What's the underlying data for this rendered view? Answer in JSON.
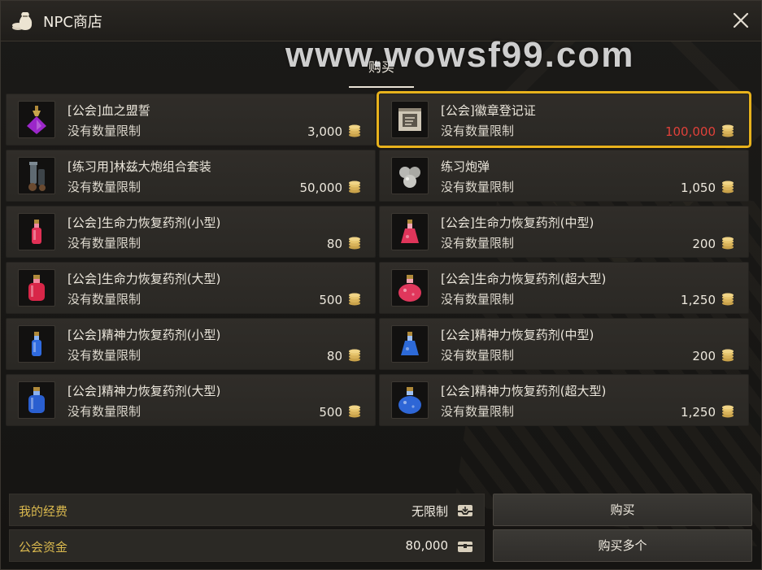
{
  "window": {
    "title": "NPC商店"
  },
  "watermark": "www.wowsf99.com",
  "tabs": [
    {
      "label": "购买",
      "active": true
    }
  ],
  "items": [
    {
      "name": "[公会]血之盟誓",
      "limit": "没有数量限制",
      "price": "3,000",
      "icon": "purple-potion-icon",
      "selected": false,
      "price_color": "#ece7dc"
    },
    {
      "name": "[公会]徽章登记证",
      "limit": "没有数量限制",
      "price": "100,000",
      "icon": "registration-scroll-icon",
      "selected": true,
      "price_color": "#e0413a"
    },
    {
      "name": "[练习用]林兹大炮组合套装",
      "limit": "没有数量限制",
      "price": "50,000",
      "icon": "cannon-set-icon",
      "selected": false,
      "price_color": "#ece7dc"
    },
    {
      "name": "练习炮弹",
      "limit": "没有数量限制",
      "price": "1,050",
      "icon": "cannonball-icon",
      "selected": false,
      "price_color": "#ece7dc"
    },
    {
      "name": "[公会]生命力恢复药剂(小型)",
      "limit": "没有数量限制",
      "price": "80",
      "icon": "red-potion-small-icon",
      "selected": false,
      "price_color": "#ece7dc"
    },
    {
      "name": "[公会]生命力恢复药剂(中型)",
      "limit": "没有数量限制",
      "price": "200",
      "icon": "red-potion-medium-icon",
      "selected": false,
      "price_color": "#ece7dc"
    },
    {
      "name": "[公会]生命力恢复药剂(大型)",
      "limit": "没有数量限制",
      "price": "500",
      "icon": "red-potion-large-icon",
      "selected": false,
      "price_color": "#ece7dc"
    },
    {
      "name": "[公会]生命力恢复药剂(超大型)",
      "limit": "没有数量限制",
      "price": "1,250",
      "icon": "red-potion-xlarge-icon",
      "selected": false,
      "price_color": "#ece7dc"
    },
    {
      "name": "[公会]精神力恢复药剂(小型)",
      "limit": "没有数量限制",
      "price": "80",
      "icon": "blue-potion-small-icon",
      "selected": false,
      "price_color": "#ece7dc"
    },
    {
      "name": "[公会]精神力恢复药剂(中型)",
      "limit": "没有数量限制",
      "price": "200",
      "icon": "blue-potion-medium-icon",
      "selected": false,
      "price_color": "#ece7dc"
    },
    {
      "name": "[公会]精神力恢复药剂(大型)",
      "limit": "没有数量限制",
      "price": "500",
      "icon": "blue-potion-large-icon",
      "selected": false,
      "price_color": "#ece7dc"
    },
    {
      "name": "[公会]精神力恢复药剂(超大型)",
      "limit": "没有数量限制",
      "price": "1,250",
      "icon": "blue-potion-xlarge-icon",
      "selected": false,
      "price_color": "#ece7dc"
    }
  ],
  "footer": {
    "funds_label": "我的经费",
    "funds_value": "无限制",
    "guild_label": "公会资金",
    "guild_value": "80,000",
    "buy_button": "购买",
    "buy_many_button": "购买多个"
  },
  "colors": {
    "accent_selected": "#e8b21c",
    "gold_label": "#d9b84e",
    "price_red": "#e0413a"
  }
}
